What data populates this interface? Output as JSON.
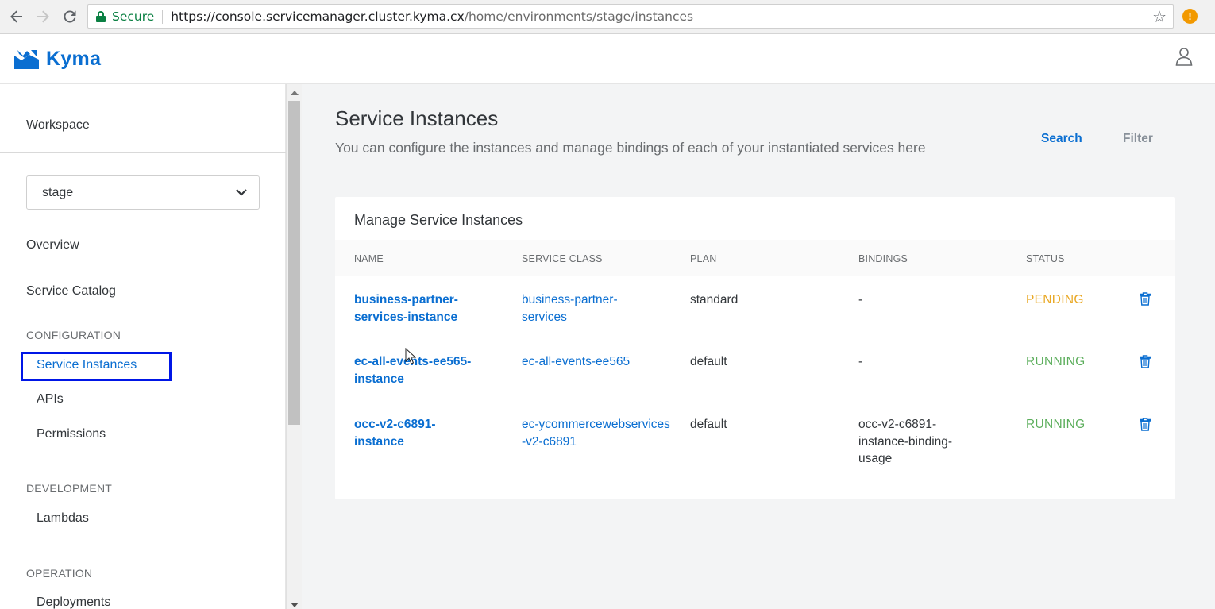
{
  "browser": {
    "secure_label": "Secure",
    "url_host": "https://console.servicemanager.cluster.kyma.cx",
    "url_path": "/home/environments/stage/instances"
  },
  "app": {
    "brand": "Kyma"
  },
  "sidebar": {
    "workspace": "Workspace",
    "environment": "stage",
    "overview": "Overview",
    "service_catalog": "Service Catalog",
    "sections": [
      {
        "label": "CONFIGURATION",
        "items": [
          "Service Instances",
          "APIs",
          "Permissions"
        ]
      },
      {
        "label": "DEVELOPMENT",
        "items": [
          "Lambdas"
        ]
      },
      {
        "label": "OPERATION",
        "items": [
          "Deployments"
        ]
      }
    ]
  },
  "main": {
    "title": "Service Instances",
    "subtitle": "You can configure the instances and manage bindings of each of your instantiated services here",
    "search_label": "Search",
    "filter_label": "Filter",
    "card_title": "Manage Service Instances",
    "columns": [
      "NAME",
      "SERVICE CLASS",
      "PLAN",
      "BINDINGS",
      "STATUS"
    ],
    "rows": [
      {
        "name": "business-partner-services-instance",
        "service_class": "business-partner-services",
        "plan": "standard",
        "bindings": "-",
        "status": "PENDING"
      },
      {
        "name": "ec-all-events-ee565-instance",
        "service_class": "ec-all-events-ee565",
        "plan": "default",
        "bindings": "-",
        "status": "RUNNING"
      },
      {
        "name": "occ-v2-c6891-instance",
        "service_class": "ec-ycommercewebservices-v2-c6891",
        "plan": "default",
        "bindings": "occ-v2-c6891-instance-binding-usage",
        "status": "RUNNING"
      }
    ]
  },
  "colors": {
    "accent": "#0a6ed1",
    "pending": "#e9a825",
    "running": "#5cae5c",
    "active_outline": "#0016e6"
  }
}
